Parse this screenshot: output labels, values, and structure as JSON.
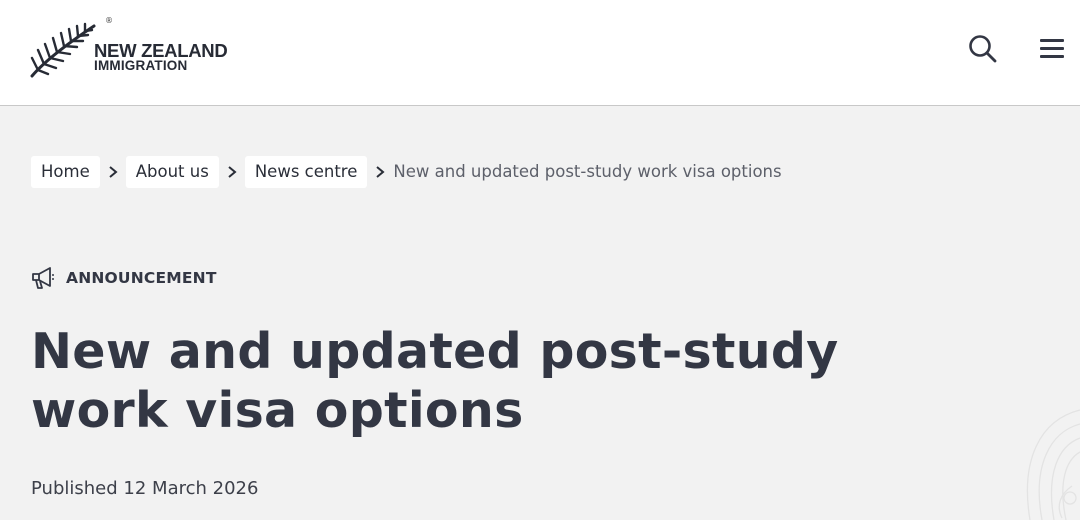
{
  "header": {
    "logo": {
      "line1": "NEW ZEALAND",
      "line2": "IMMIGRATION",
      "registered_mark": "®",
      "icon": "silver-fern-icon"
    },
    "search_icon": "search-icon",
    "menu_icon": "hamburger-menu-icon"
  },
  "breadcrumb": {
    "items": [
      {
        "label": "Home"
      },
      {
        "label": "About us"
      },
      {
        "label": "News centre"
      }
    ],
    "current": "New and updated post-study work visa options",
    "separator_icon": "chevron-right-icon"
  },
  "article": {
    "category": "ANNOUNCEMENT",
    "category_icon": "megaphone-icon",
    "title": "New and updated post-study work visa options",
    "published_label": "Published",
    "published_date": "12 March 2026"
  },
  "colors": {
    "background": "#f2f2f2",
    "header_background": "#ffffff",
    "text_primary": "#333744",
    "text_muted": "#5d606a"
  }
}
